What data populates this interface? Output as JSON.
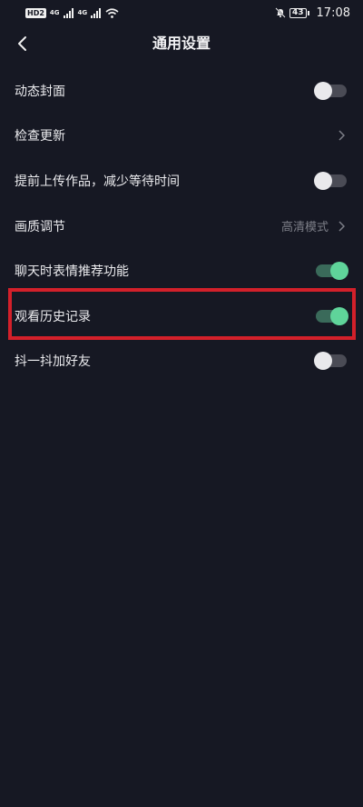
{
  "status_bar": {
    "hd_label": "HD",
    "hd_num": "2",
    "net1": "4G",
    "net2": "4G",
    "battery": "43",
    "time": "17:08"
  },
  "header": {
    "title": "通用设置"
  },
  "settings": [
    {
      "label": "动态封面",
      "control": "toggle",
      "on": false
    },
    {
      "label": "检查更新",
      "control": "chevron"
    },
    {
      "label": "提前上传作品，减少等待时间",
      "control": "toggle",
      "on": false
    },
    {
      "label": "画质调节",
      "control": "chevron",
      "value": "高清模式"
    },
    {
      "label": "聊天时表情推荐功能",
      "control": "toggle",
      "on": true
    },
    {
      "label": "观看历史记录",
      "control": "toggle",
      "on": true
    },
    {
      "label": "抖一抖加好友",
      "control": "toggle",
      "on": false
    }
  ],
  "colors": {
    "background": "#161823",
    "toggle_on": "#5fd49a",
    "toggle_off": "#e9e9ec",
    "highlight": "#d3202a"
  }
}
